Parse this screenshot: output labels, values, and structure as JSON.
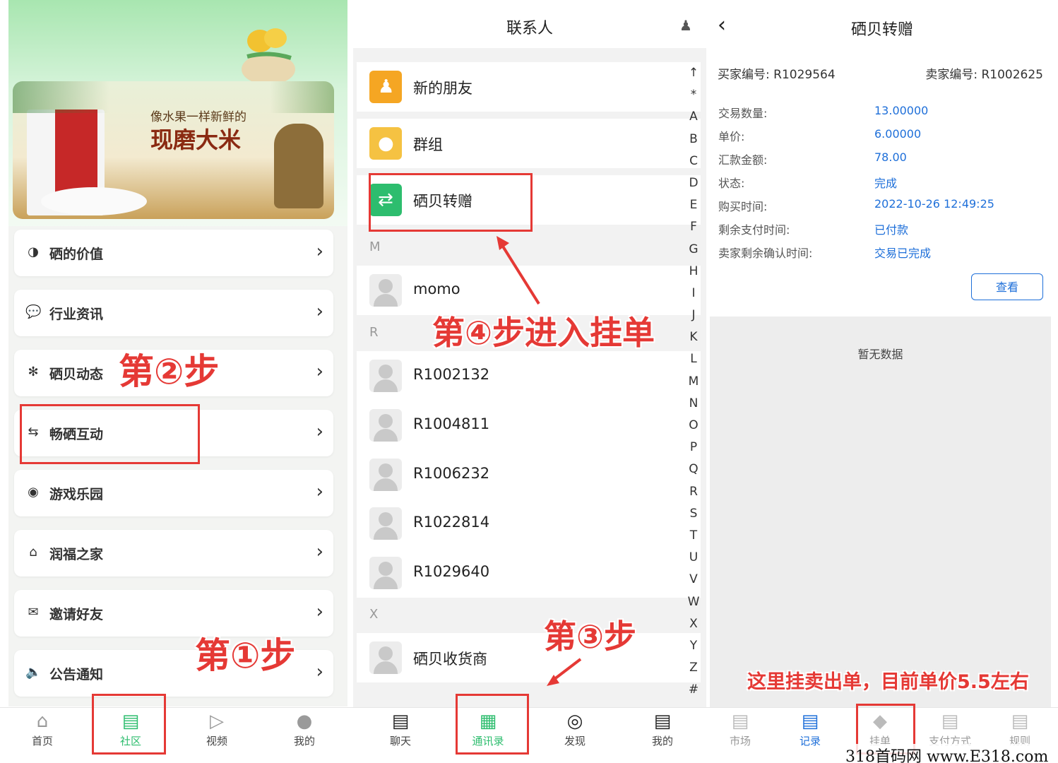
{
  "panel1": {
    "banner": {
      "line1": "像水果一样新鲜的",
      "line2": "现磨大米"
    },
    "menu": [
      {
        "icon": "coin-icon",
        "label": "硒的价值"
      },
      {
        "icon": "chat-icon",
        "label": "行业资讯"
      },
      {
        "icon": "pinwheel-icon",
        "label": "硒贝动态"
      },
      {
        "icon": "interaction-icon",
        "label": "畅硒互动"
      },
      {
        "icon": "gamepad-icon",
        "label": "游戏乐园"
      },
      {
        "icon": "home-icon",
        "label": "润福之家"
      },
      {
        "icon": "invite-icon",
        "label": "邀请好友"
      },
      {
        "icon": "speaker-icon",
        "label": "公告通知"
      }
    ],
    "tabs": [
      {
        "icon": "home-icon",
        "label": "首页"
      },
      {
        "icon": "community-icon",
        "label": "社区"
      },
      {
        "icon": "video-icon",
        "label": "视频"
      },
      {
        "icon": "user-icon",
        "label": "我的"
      }
    ],
    "annotations": {
      "step1": "第①步",
      "step2": "第②步"
    }
  },
  "panel2": {
    "title": "联系人",
    "top_items": [
      {
        "icon": "new-friend-icon",
        "name": "新的朋友",
        "color": "#f5a623"
      },
      {
        "icon": "group-icon",
        "name": "群组",
        "color": "#f5c242"
      },
      {
        "icon": "transfer-icon",
        "name": "硒贝转赠",
        "color": "#2dbd6e"
      }
    ],
    "sections": [
      {
        "letter": "M",
        "contacts": [
          "momo"
        ]
      },
      {
        "letter": "R",
        "contacts": [
          "R1002132",
          "R1004811",
          "R1006232",
          "R1022814",
          "R1029640"
        ]
      },
      {
        "letter": "X",
        "contacts": [
          "硒贝收货商"
        ]
      }
    ],
    "index": [
      "↑",
      "*",
      "A",
      "B",
      "C",
      "D",
      "E",
      "F",
      "G",
      "H",
      "I",
      "J",
      "K",
      "L",
      "M",
      "N",
      "O",
      "P",
      "Q",
      "R",
      "S",
      "T",
      "U",
      "V",
      "W",
      "X",
      "Y",
      "Z",
      "#"
    ],
    "tabs": [
      {
        "icon": "chat-bubble-icon",
        "label": "聊天"
      },
      {
        "icon": "contacts-icon",
        "label": "通讯录"
      },
      {
        "icon": "compass-icon",
        "label": "发现"
      },
      {
        "icon": "profile-icon",
        "label": "我的"
      }
    ],
    "annotations": {
      "step3": "第③步",
      "step4": "第④步进入挂单"
    }
  },
  "panel3": {
    "title": "硒贝转赠",
    "buyer_label": "买家编号: R1029564",
    "seller_label": "卖家编号: R1002625",
    "rows": [
      {
        "label": "交易数量:",
        "value": "13.00000"
      },
      {
        "label": "单价:",
        "value": "6.00000"
      },
      {
        "label": "汇款金额:",
        "value": "78.00"
      },
      {
        "label": "状态:",
        "value": "完成"
      },
      {
        "label": "购买时间:",
        "value": "2022-10-26 12:49:25"
      },
      {
        "label": "剩余支付时间:",
        "value": "已付款"
      },
      {
        "label": "卖家剩余确认时间:",
        "value": "交易已完成"
      }
    ],
    "view_button": "查看",
    "empty_text": "暂无数据",
    "tabs": [
      {
        "icon": "market-icon",
        "label": "市场"
      },
      {
        "icon": "record-icon",
        "label": "记录"
      },
      {
        "icon": "listing-icon",
        "label": "挂单"
      },
      {
        "icon": "payment-icon",
        "label": "支付方式"
      },
      {
        "icon": "rules-icon",
        "label": "规则"
      }
    ],
    "annotation": "这里挂卖出单，目前单价5.5左右"
  },
  "watermark": "318首码网 www.E318.com",
  "colors": {
    "accent_green": "#2dbd6e",
    "annotation_red": "#e53935",
    "link_blue": "#1e6fd9"
  }
}
